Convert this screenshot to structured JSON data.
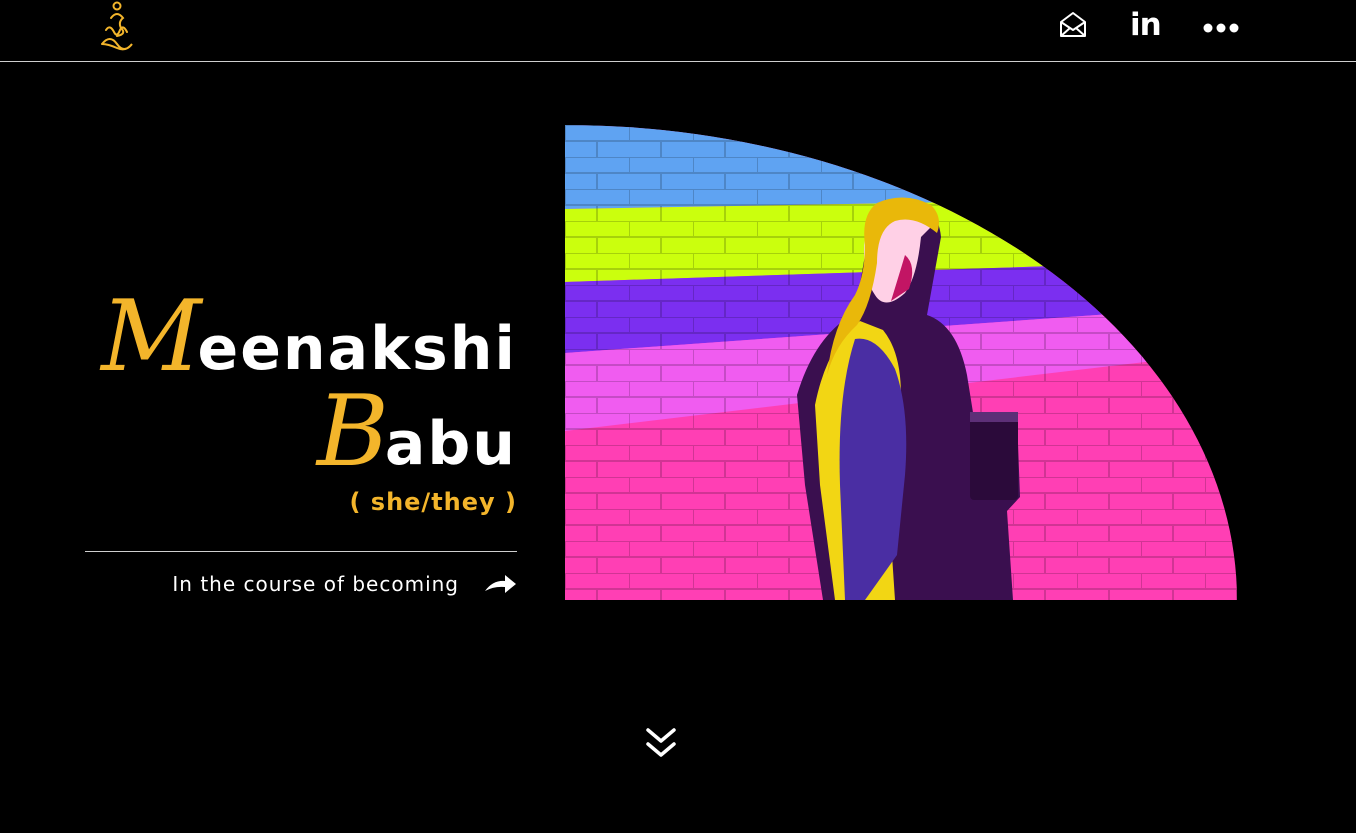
{
  "header": {
    "logo_icon": "meditation-logo-icon",
    "nav": [
      {
        "icon": "mail-icon"
      },
      {
        "icon": "linkedin-icon",
        "label": "in"
      },
      {
        "icon": "more-dots-icon"
      }
    ]
  },
  "hero": {
    "first_name_initial": "M",
    "first_name_rest": "eenakshi",
    "last_name_initial": "B",
    "last_name_rest": "abu",
    "pronouns": "( she/they )",
    "cta_label": "In the course of becoming",
    "cta_icon": "arrow-right-icon",
    "image_icon": "portrait-illustration"
  },
  "scroll_icon": "double-chevron-down-icon",
  "colors": {
    "background": "#000000",
    "accent": "#f3b52b",
    "stripe_blue": "#5fa3f2",
    "stripe_lime": "#cbff0d",
    "stripe_purple": "#7b2ff0",
    "stripe_pink": "#ff3fb4"
  }
}
